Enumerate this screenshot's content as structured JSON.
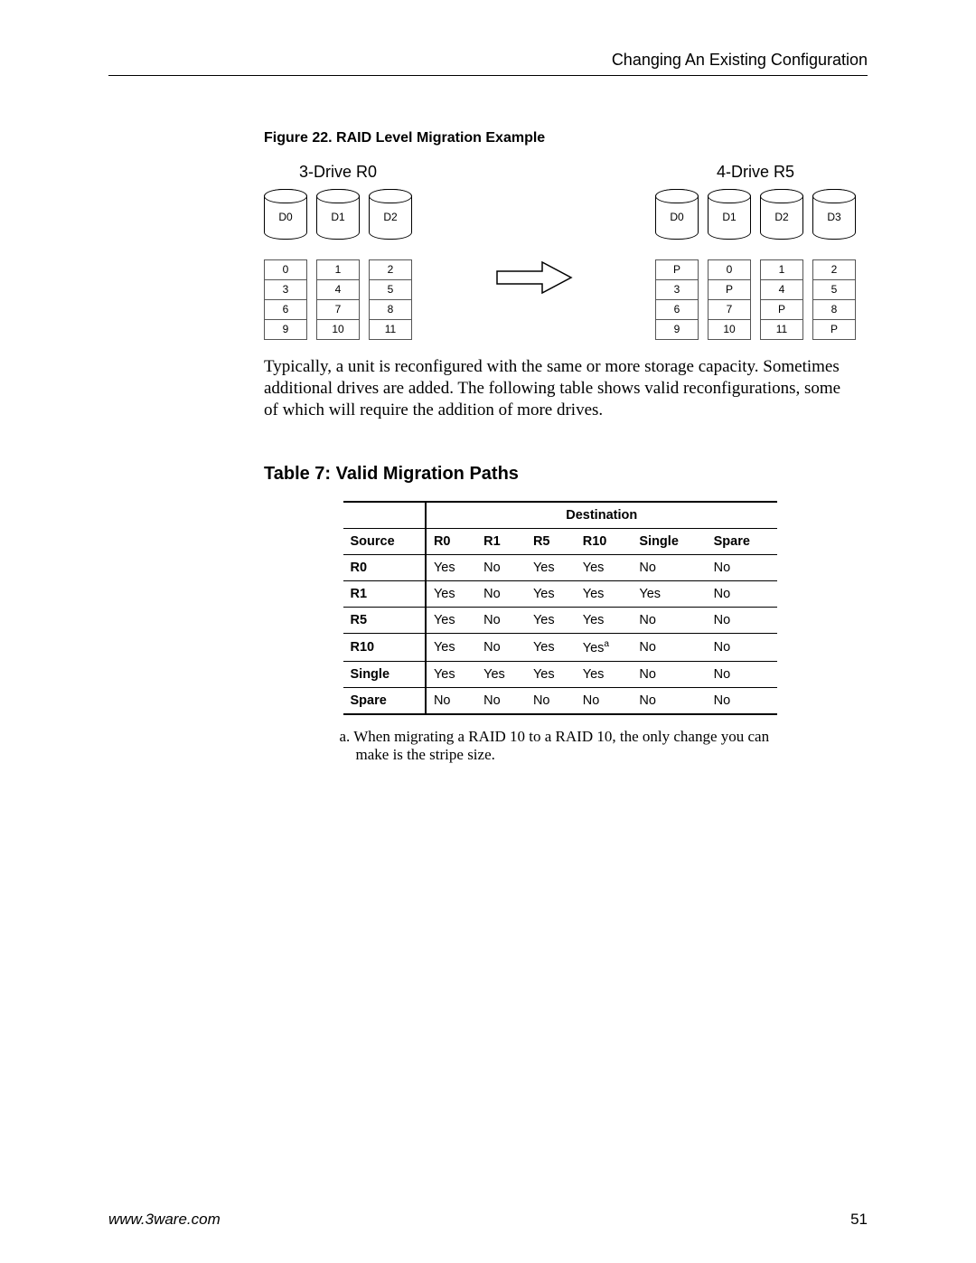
{
  "header": {
    "title": "Changing An Existing Configuration"
  },
  "figure": {
    "caption": "Figure 22.   RAID Level Migration Example",
    "left": {
      "title": "3-Drive R0",
      "drives": [
        "D0",
        "D1",
        "D2"
      ],
      "cells": [
        [
          "0",
          "1",
          "2"
        ],
        [
          "3",
          "4",
          "5"
        ],
        [
          "6",
          "7",
          "8"
        ],
        [
          "9",
          "10",
          "11"
        ]
      ]
    },
    "right": {
      "title": "4-Drive R5",
      "drives": [
        "D0",
        "D1",
        "D2",
        "D3"
      ],
      "cells": [
        [
          "P",
          "0",
          "1",
          "2"
        ],
        [
          "3",
          "P",
          "4",
          "5"
        ],
        [
          "6",
          "7",
          "P",
          "8"
        ],
        [
          "9",
          "10",
          "11",
          "P"
        ]
      ]
    }
  },
  "paragraph": "Typically, a unit is reconfigured with the same or more storage capacity. Sometimes additional drives are added. The following table shows valid reconfigurations, some of which will require the addition of more drives.",
  "table": {
    "title": "Table 7: Valid Migration Paths",
    "source_label": "Source",
    "dest_label": "Destination",
    "columns": [
      "R0",
      "R1",
      "R5",
      "R10",
      "Single",
      "Spare"
    ],
    "rows": [
      {
        "src": "R0",
        "vals": [
          "Yes",
          "No",
          "Yes",
          "Yes",
          "No",
          "No"
        ]
      },
      {
        "src": "R1",
        "vals": [
          "Yes",
          "No",
          "Yes",
          "Yes",
          "Yes",
          "No"
        ]
      },
      {
        "src": "R5",
        "vals": [
          "Yes",
          "No",
          "Yes",
          "Yes",
          "No",
          "No"
        ]
      },
      {
        "src": "R10",
        "vals": [
          "Yes",
          "No",
          "Yes",
          "Yes",
          "No",
          "No"
        ],
        "note_index": 3,
        "note_mark": "a"
      },
      {
        "src": "Single",
        "vals": [
          "Yes",
          "Yes",
          "Yes",
          "Yes",
          "No",
          "No"
        ]
      },
      {
        "src": "Spare",
        "vals": [
          "No",
          "No",
          "No",
          "No",
          "No",
          "No"
        ]
      }
    ],
    "footnote_mark": "a.",
    "footnote": "When migrating a RAID 10 to a RAID 10, the only change you can make is the stripe size."
  },
  "chart_data": {
    "type": "table",
    "title": "Valid Migration Paths",
    "source": [
      "R0",
      "R1",
      "R5",
      "R10",
      "Single",
      "Spare"
    ],
    "destination": [
      "R0",
      "R1",
      "R5",
      "R10",
      "Single",
      "Spare"
    ],
    "matrix": [
      [
        "Yes",
        "No",
        "Yes",
        "Yes",
        "No",
        "No"
      ],
      [
        "Yes",
        "No",
        "Yes",
        "Yes",
        "Yes",
        "No"
      ],
      [
        "Yes",
        "No",
        "Yes",
        "Yes",
        "No",
        "No"
      ],
      [
        "Yes",
        "No",
        "Yes",
        "Yes",
        "No",
        "No"
      ],
      [
        "Yes",
        "Yes",
        "Yes",
        "Yes",
        "No",
        "No"
      ],
      [
        "No",
        "No",
        "No",
        "No",
        "No",
        "No"
      ]
    ],
    "note": "When migrating a RAID 10 to a RAID 10, the only change you can make is the stripe size."
  },
  "footer": {
    "url": "www.3ware.com",
    "page": "51"
  }
}
